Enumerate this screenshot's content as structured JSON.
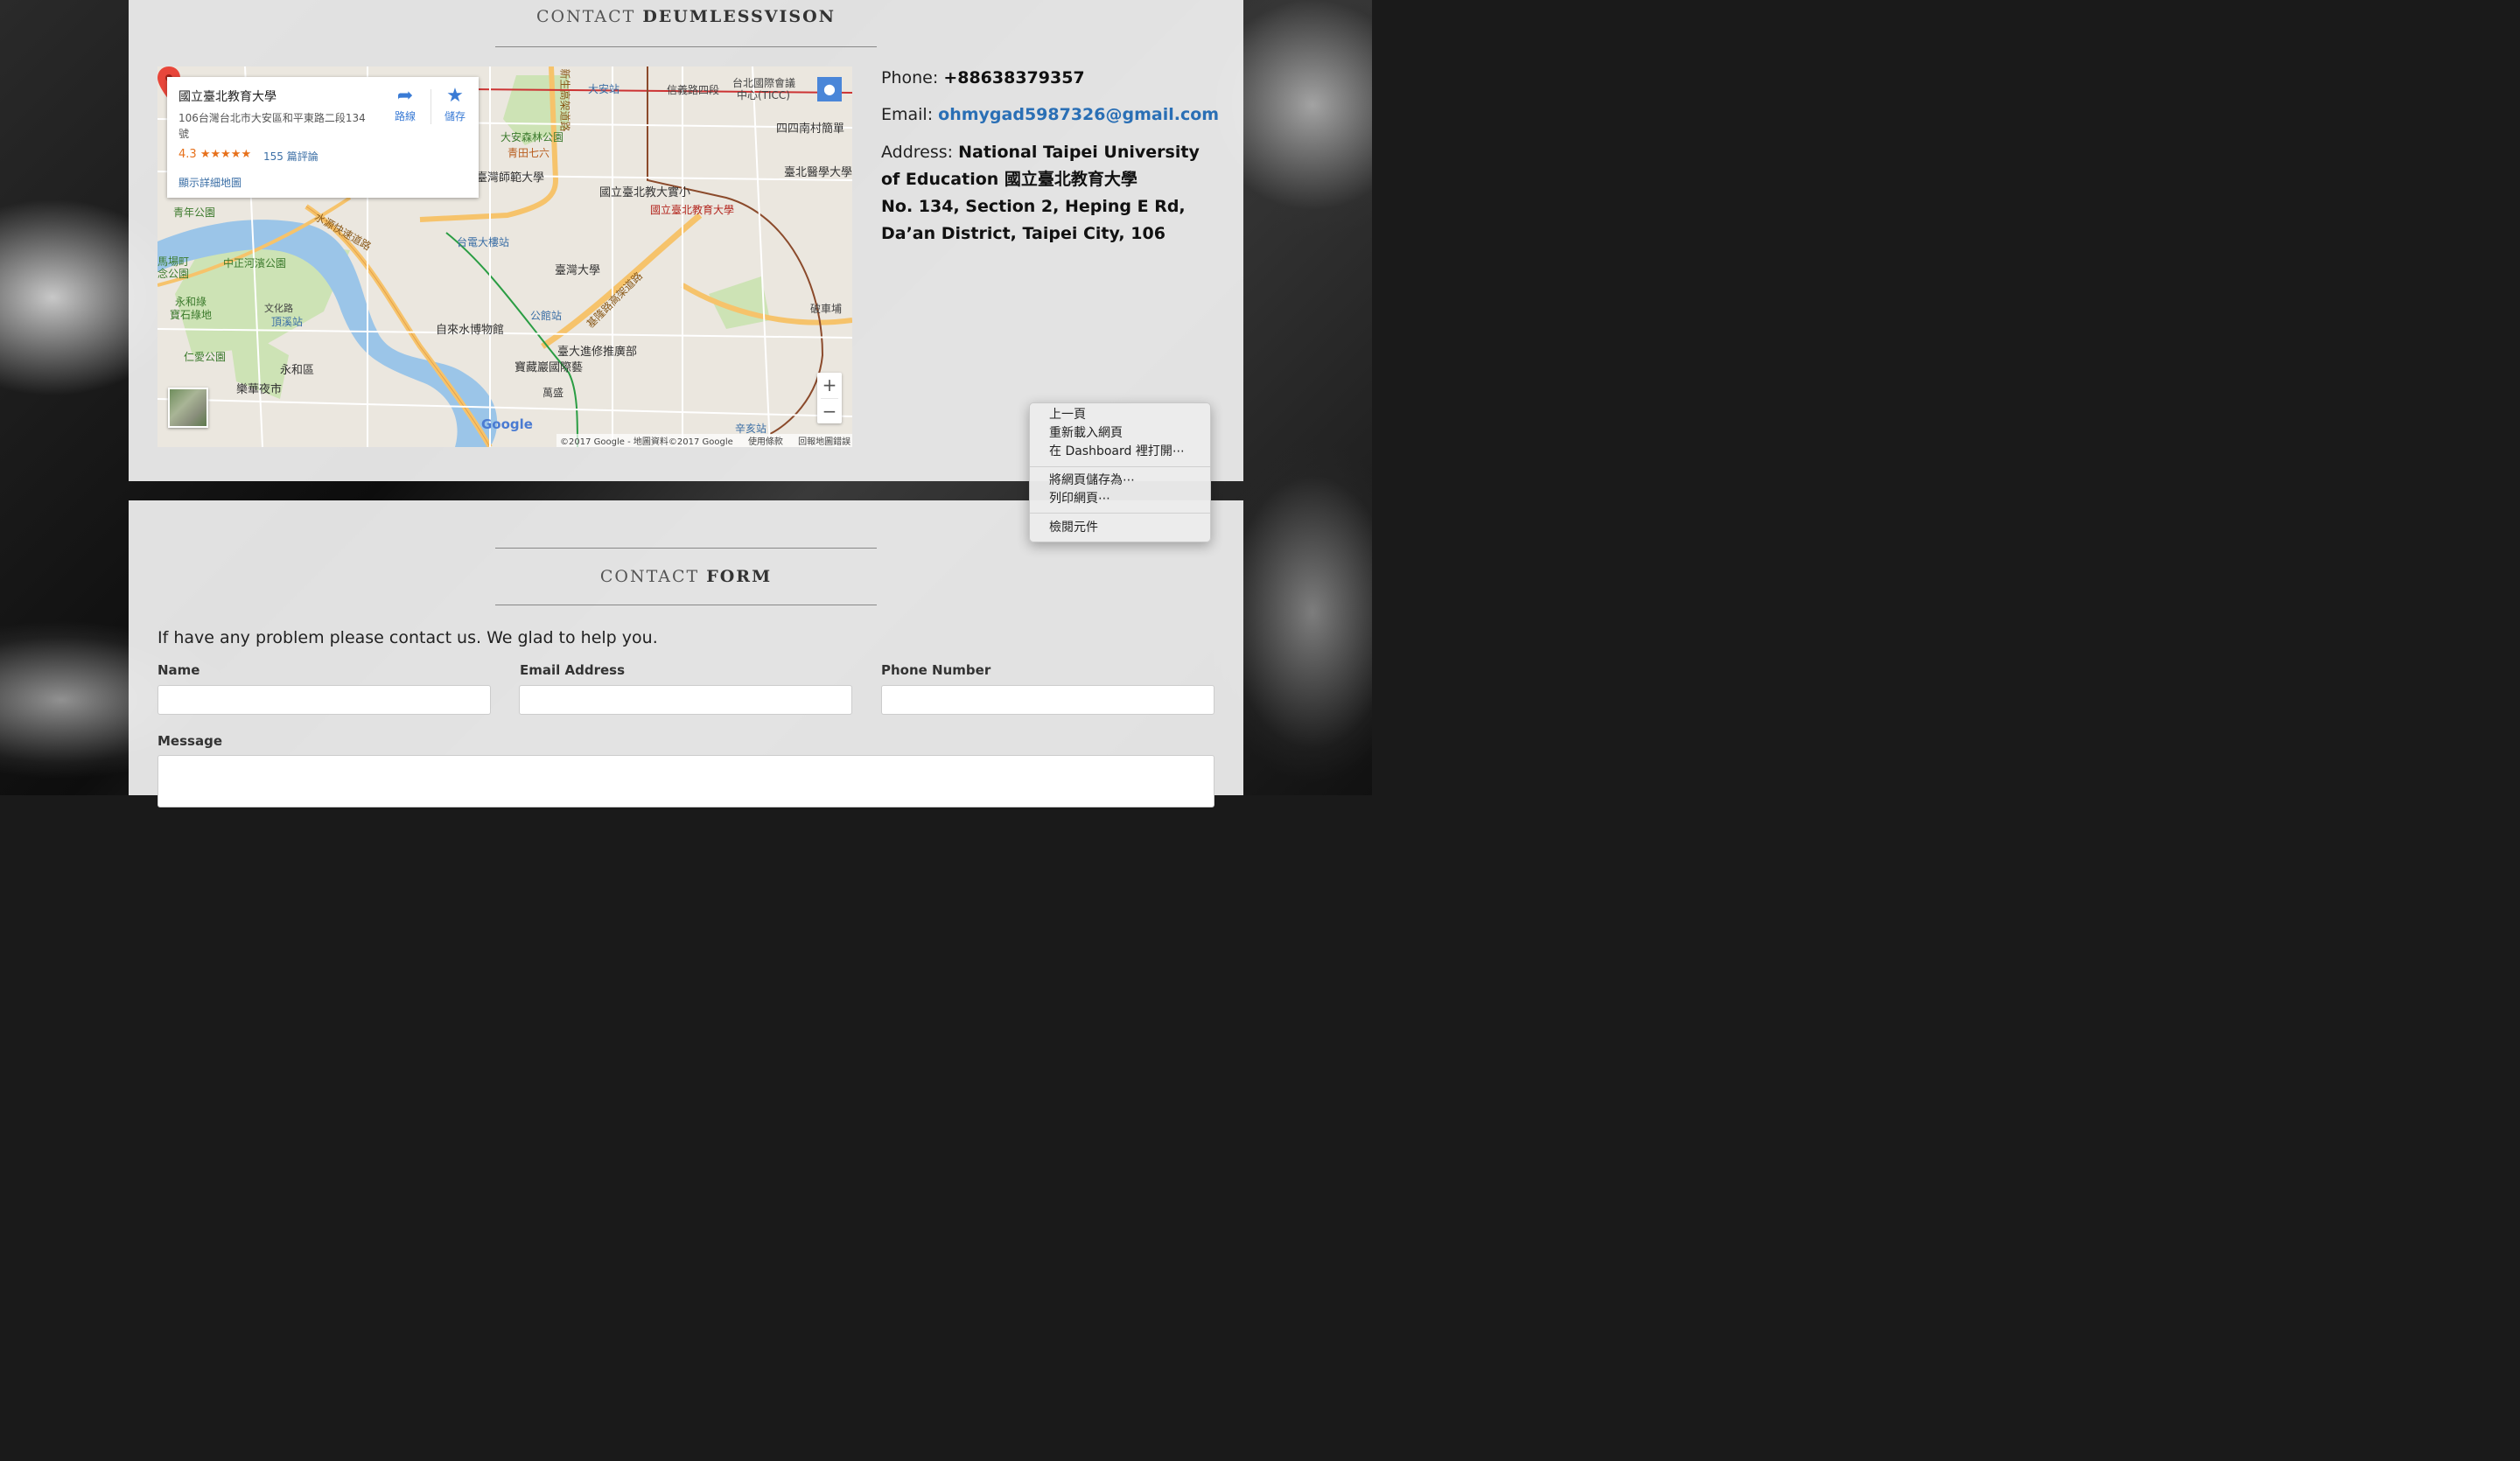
{
  "contact": {
    "title_thin": "CONTACT",
    "title_bold": "DEUMLESSVISON",
    "phone_label": "Phone:",
    "phone_value": "+88638379357",
    "email_label": "Email:",
    "email_value": "ohmygad5987326@gmail.com",
    "address_label": "Address:",
    "address_line1": "National Taipei University of Education 國立臺北教育大學",
    "address_line2": "No. 134, Section 2, Heping E Rd, Da’an District, Taipei City, 106"
  },
  "map": {
    "card": {
      "name": "國立臺北教育大學",
      "address": "106台灣台北市大安區和平東路二段134號",
      "rating": "4.3",
      "stars": "★★★★★",
      "reviews": "155 篇評論",
      "larger_map": "顯示詳細地圖",
      "directions": "路線",
      "save": "儲存"
    },
    "zoom_in": "+",
    "zoom_out": "−",
    "google": "Google",
    "copyright": "©2017 Google - 地圖資料©2017 Google",
    "terms": "使用條款",
    "report": "回報地圖錯誤",
    "pin_label": "國立臺北教育大學",
    "labels": {
      "l1": "台北國際會議",
      "l2": "中心(TICC)",
      "l3": "四四南村簡單",
      "l4": "大安森林公園",
      "l5": "青田七六",
      "l6": "臺灣師範大學",
      "l7": "國立臺北教大實小",
      "l8": "臺北醫學大學",
      "l9": "青年公園",
      "l10": "台電大樓站",
      "l11": "臺灣大學",
      "l12": "中正河濱公園",
      "l13": "馬場町",
      "l14": "念公園",
      "l15": "永和綠",
      "l16": "寶石綠地",
      "l17": "頂溪站",
      "l18": "自來水博物館",
      "l19": "公館站",
      "l20": "臺大進修推廣部",
      "l21": "寶藏巖國際藝",
      "l22": "仁愛公園",
      "l23": "永和區",
      "l24": "樂華夜市",
      "l25": "萬盛",
      "l26": "破車埔",
      "l27": "辛亥站",
      "l28": "大安站",
      "l29": "信義路四段",
      "l30": "水源快速道路",
      "l31": "基隆路高架道路",
      "l32": "新生高架道路",
      "l33": "文化路"
    }
  },
  "context_menu": {
    "back": "上一頁",
    "reload": "重新載入網頁",
    "open_dashboard": "在 Dashboard 裡打開⋯",
    "save_as": "將網頁儲存為⋯",
    "print": "列印網頁⋯",
    "inspect": "檢閱元件"
  },
  "form": {
    "title_thin": "CONTACT",
    "title_bold": "FORM",
    "intro": "If have any problem please contact us. We glad to help you.",
    "name_label": "Name",
    "email_label": "Email Address",
    "phone_label": "Phone Number",
    "message_label": "Message",
    "name_value": "",
    "email_value": "",
    "phone_value": "",
    "message_value": ""
  }
}
